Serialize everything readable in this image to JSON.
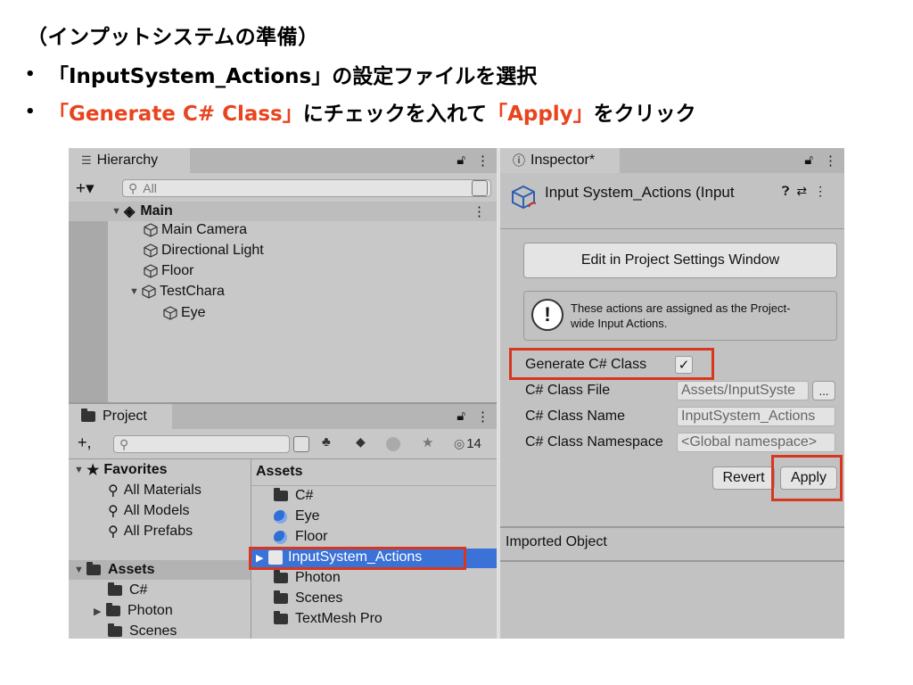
{
  "slide": {
    "heading": "（インプットシステムの準備）",
    "bullet1": {
      "marker": "•",
      "text": "「InputSystem_Actions」の設定ファイルを選択"
    },
    "bullet2": {
      "marker": "•",
      "part1": "「Generate C# Class」",
      "part2": "にチェックを入れて",
      "part3": "「Apply」",
      "part4": "をクリック"
    }
  },
  "colors": {
    "highlight": "#e8441f",
    "selection": "#3a72d8",
    "callout_box": "#d7371e"
  },
  "hierarchy": {
    "tab_label": "Hierarchy",
    "tab_icon": "list-icon",
    "add_label": "+▾",
    "search_placeholder": "All",
    "scene": {
      "label": "Main",
      "icon": "unity-scene-icon"
    },
    "items": [
      {
        "label": "Main Camera",
        "icon": "gameobject-cube-icon"
      },
      {
        "label": "Directional Light",
        "icon": "gameobject-cube-icon"
      },
      {
        "label": "Floor",
        "icon": "gameobject-cube-icon"
      },
      {
        "label": "TestChara",
        "icon": "gameobject-cube-icon"
      },
      {
        "label": "Eye",
        "icon": "gameobject-cube-icon"
      }
    ]
  },
  "project": {
    "tab_label": "Project",
    "tab_icon": "folder-icon",
    "add_label": "+,",
    "hidden_count": "14",
    "favorites": {
      "label": "Favorites",
      "items": [
        "All Materials",
        "All Models",
        "All Prefabs"
      ]
    },
    "assets_tree": {
      "label": "Assets",
      "items": [
        "C#",
        "Photon",
        "Scenes"
      ]
    },
    "assets_header": "Assets",
    "assets_list": [
      {
        "label": "C#",
        "icon": "folder-icon"
      },
      {
        "label": "Eye",
        "icon": "material-icon"
      },
      {
        "label": "Floor",
        "icon": "material-icon"
      },
      {
        "label": "InputSystem_Actions",
        "icon": "input-actions-icon",
        "selected": true
      },
      {
        "label": "Photon",
        "icon": "folder-icon"
      },
      {
        "label": "Scenes",
        "icon": "folder-icon"
      },
      {
        "label": "TextMesh Pro",
        "icon": "folder-icon"
      }
    ]
  },
  "inspector": {
    "tab_label": "Inspector*",
    "tab_icon": "info-icon",
    "title": "Input System_Actions (Input",
    "edit_button": "Edit in Project Settings Window",
    "info_text_line1": "These actions are assigned as the Project-",
    "info_text_line2": "wide Input Actions.",
    "generate_label": "Generate C# Class",
    "generate_checked": true,
    "class_file_label": "C# Class File",
    "class_file_value": "Assets/InputSyste",
    "browse_label": "...",
    "class_name_label": "C# Class Name",
    "class_name_value": "InputSystem_Actions",
    "namespace_label": "C# Class Namespace",
    "namespace_value": "<Global namespace>",
    "revert_label": "Revert",
    "apply_label": "Apply",
    "imported_object": "Imported Object"
  }
}
